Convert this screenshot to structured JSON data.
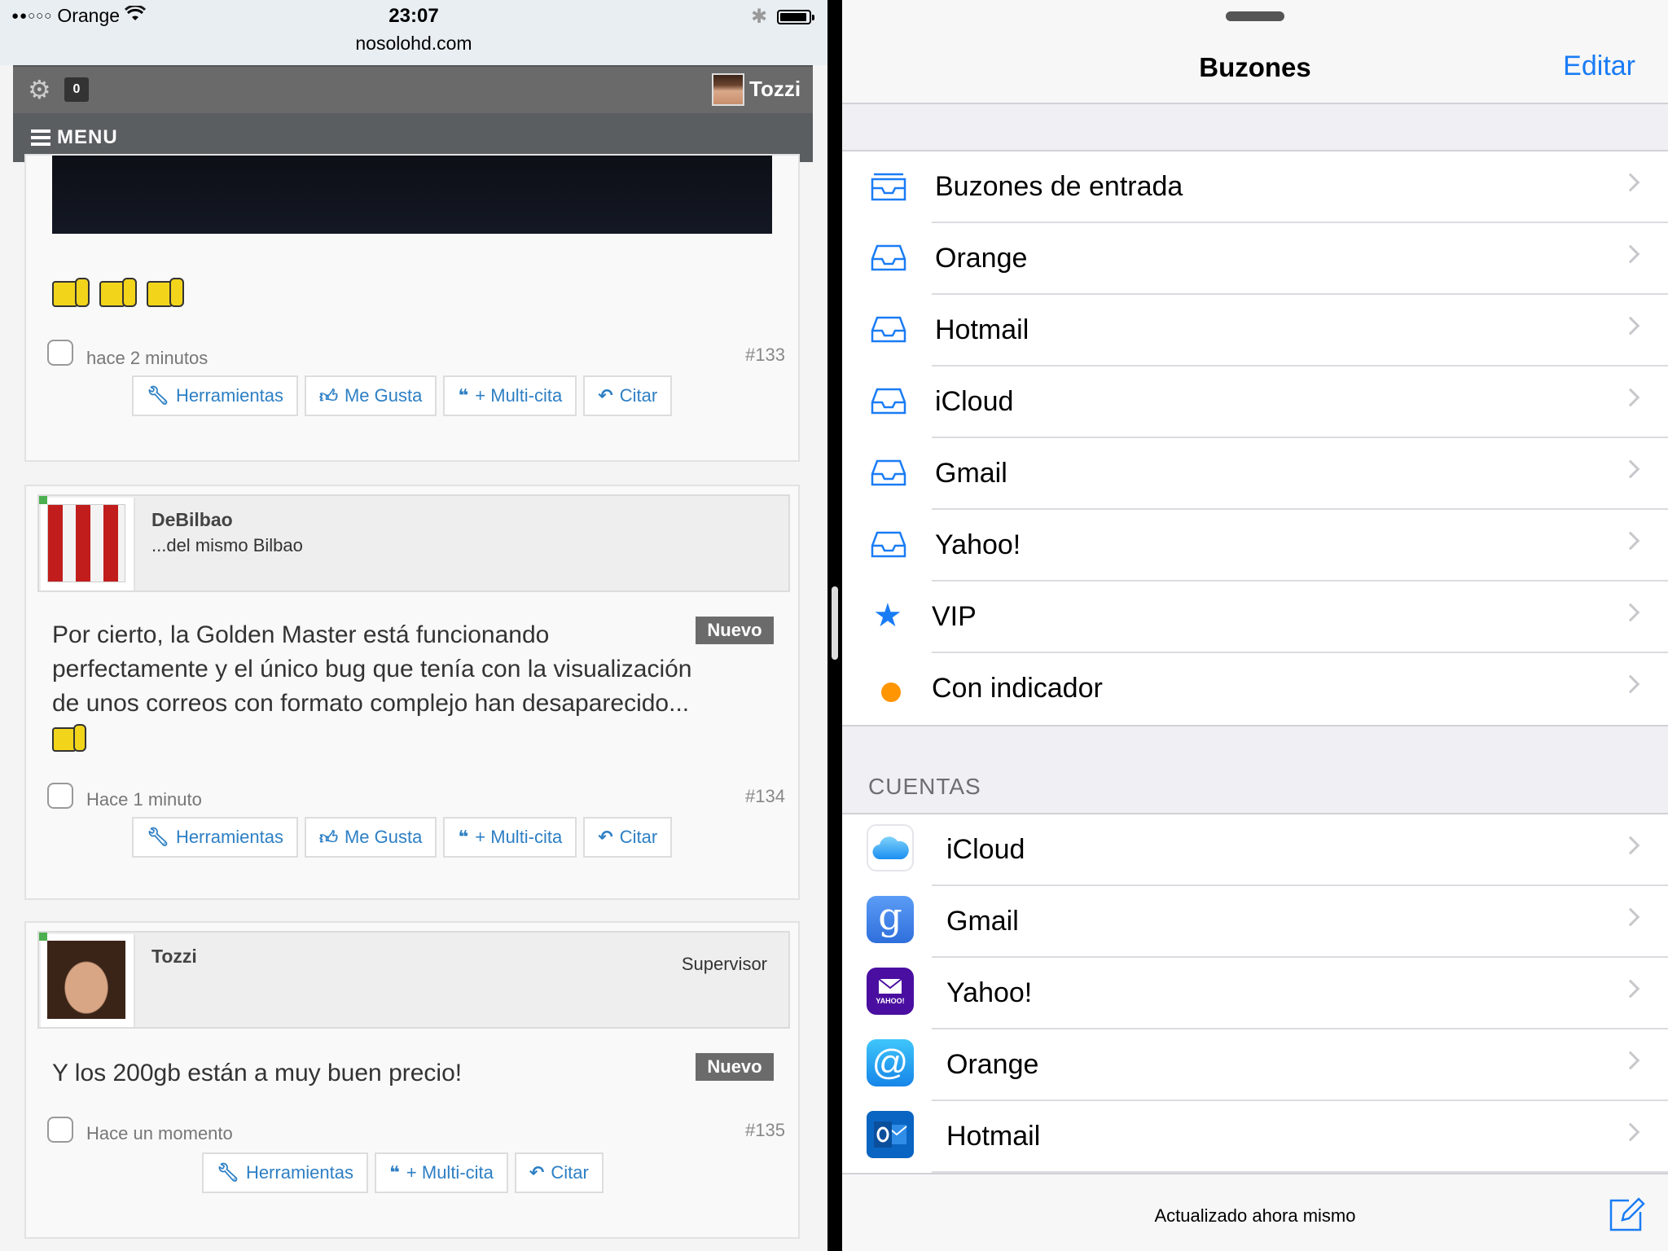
{
  "status_bar": {
    "signal": "●●○○○",
    "carrier": "Orange",
    "time": "23:07",
    "url": "nosolohd.com"
  },
  "forum_header": {
    "notification_count": "0",
    "username": "Tozzi",
    "menu_label": "MENU"
  },
  "posts": [
    {
      "time": "hace 2 minutos",
      "number": "#133",
      "buttons": [
        "Herramientas",
        "Me Gusta",
        "+ Multi-cita",
        "Citar"
      ]
    },
    {
      "author": "DeBilbao",
      "author_subtitle": "...del mismo Bilbao",
      "badge": "Nuevo",
      "body": "Por cierto, la Golden Master está funcionando perfectamente y el único bug que tenía con la visualización de unos correos con formato complejo han desaparecido...",
      "time": "Hace 1 minuto",
      "number": "#134",
      "buttons": [
        "Herramientas",
        "Me Gusta",
        "+ Multi-cita",
        "Citar"
      ]
    },
    {
      "author": "Tozzi",
      "author_role": "Supervisor",
      "badge": "Nuevo",
      "body": "Y los 200gb están a muy buen precio!",
      "time": "Hace un momento",
      "number": "#135",
      "buttons": [
        "Herramientas",
        "+ Multi-cita",
        "Citar"
      ]
    }
  ],
  "mail": {
    "title": "Buzones",
    "edit_label": "Editar",
    "mailboxes": [
      {
        "label": "Buzones de entrada",
        "icon": "all-inboxes-icon"
      },
      {
        "label": "Orange",
        "icon": "inbox-tray-icon"
      },
      {
        "label": "Hotmail",
        "icon": "inbox-tray-icon"
      },
      {
        "label": "iCloud",
        "icon": "inbox-tray-icon"
      },
      {
        "label": "Gmail",
        "icon": "inbox-tray-icon"
      },
      {
        "label": "Yahoo!",
        "icon": "inbox-tray-icon"
      },
      {
        "label": "VIP",
        "icon": "star-icon"
      },
      {
        "label": "Con indicador",
        "icon": "flag-dot-icon"
      }
    ],
    "accounts_header": "CUENTAS",
    "accounts": [
      {
        "label": "iCloud",
        "icon": "icloud-icon"
      },
      {
        "label": "Gmail",
        "icon": "gmail-icon"
      },
      {
        "label": "Yahoo!",
        "icon": "yahoo-mail-icon"
      },
      {
        "label": "Orange",
        "icon": "at-mail-icon"
      },
      {
        "label": "Hotmail",
        "icon": "outlook-icon"
      }
    ],
    "status": "Actualizado ahora mismo"
  },
  "colors": {
    "ios_blue": "#1a7cf5",
    "forum_blue": "#2d7fc4",
    "flag_orange": "#ff9500",
    "header_gray": "#6a6a6a",
    "menu_gray": "#5b5e61"
  }
}
